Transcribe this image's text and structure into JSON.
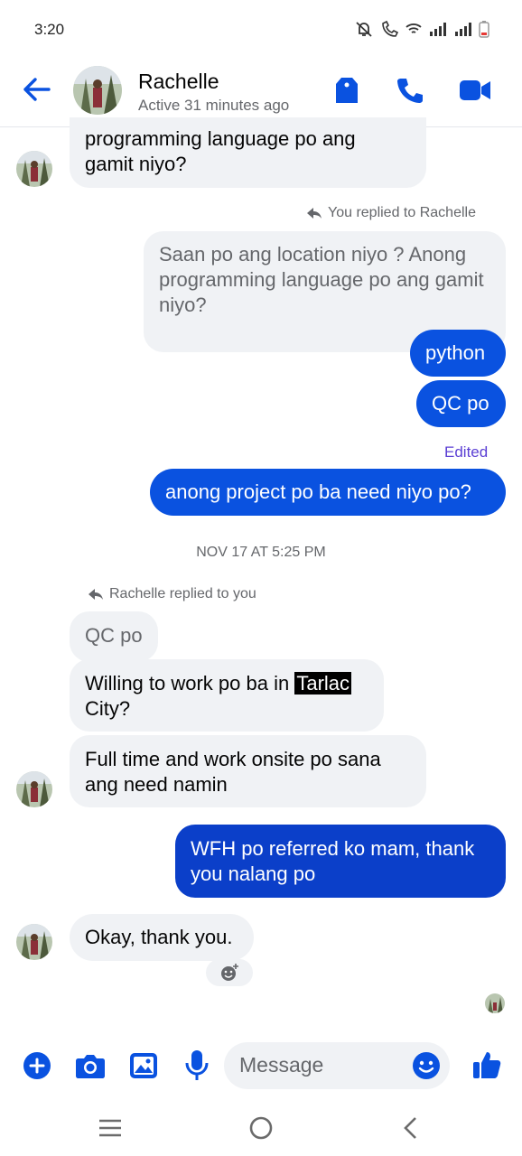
{
  "status_bar": {
    "time": "3:20"
  },
  "header": {
    "contact_name": "Rachelle",
    "contact_status": "Active 31 minutes ago"
  },
  "messages": {
    "m1_line1": "programming language po ang",
    "m1_line2": "gamit niyo?",
    "reply_label_1": "You replied to Rachelle",
    "quoted_1": "Saan po ang location niyo ? Anong programming language po ang gamit niyo?",
    "out_python": "python",
    "out_qc": "QC po",
    "edited_label": "Edited",
    "out_project": "anong project po ba need niyo po?",
    "timestamp": "NOV 17 AT 5:25 PM",
    "reply_label_2": "Rachelle replied to you",
    "quoted_2": "QC po",
    "in_willing_1": "Willing to work po ba in ",
    "in_willing_highlight": "Tarlac",
    "in_willing_2": "City?",
    "in_fulltime": "Full time and work onsite po sana ang need namin",
    "out_wfh": "WFH po referred ko mam, thank you nalang po",
    "in_okay": "Okay, thank you."
  },
  "composer": {
    "placeholder": "Message"
  },
  "colors": {
    "accent": "#0a52e0",
    "bubble_in": "#f0f2f5",
    "edited": "#5b3fd4"
  },
  "icons": [
    "back-arrow-icon",
    "tag-icon",
    "phone-icon",
    "video-icon",
    "plus-icon",
    "camera-icon",
    "gallery-icon",
    "mic-icon",
    "emoji-icon",
    "thumbs-up-icon",
    "menu-icon",
    "home-icon",
    "back-nav-icon"
  ]
}
